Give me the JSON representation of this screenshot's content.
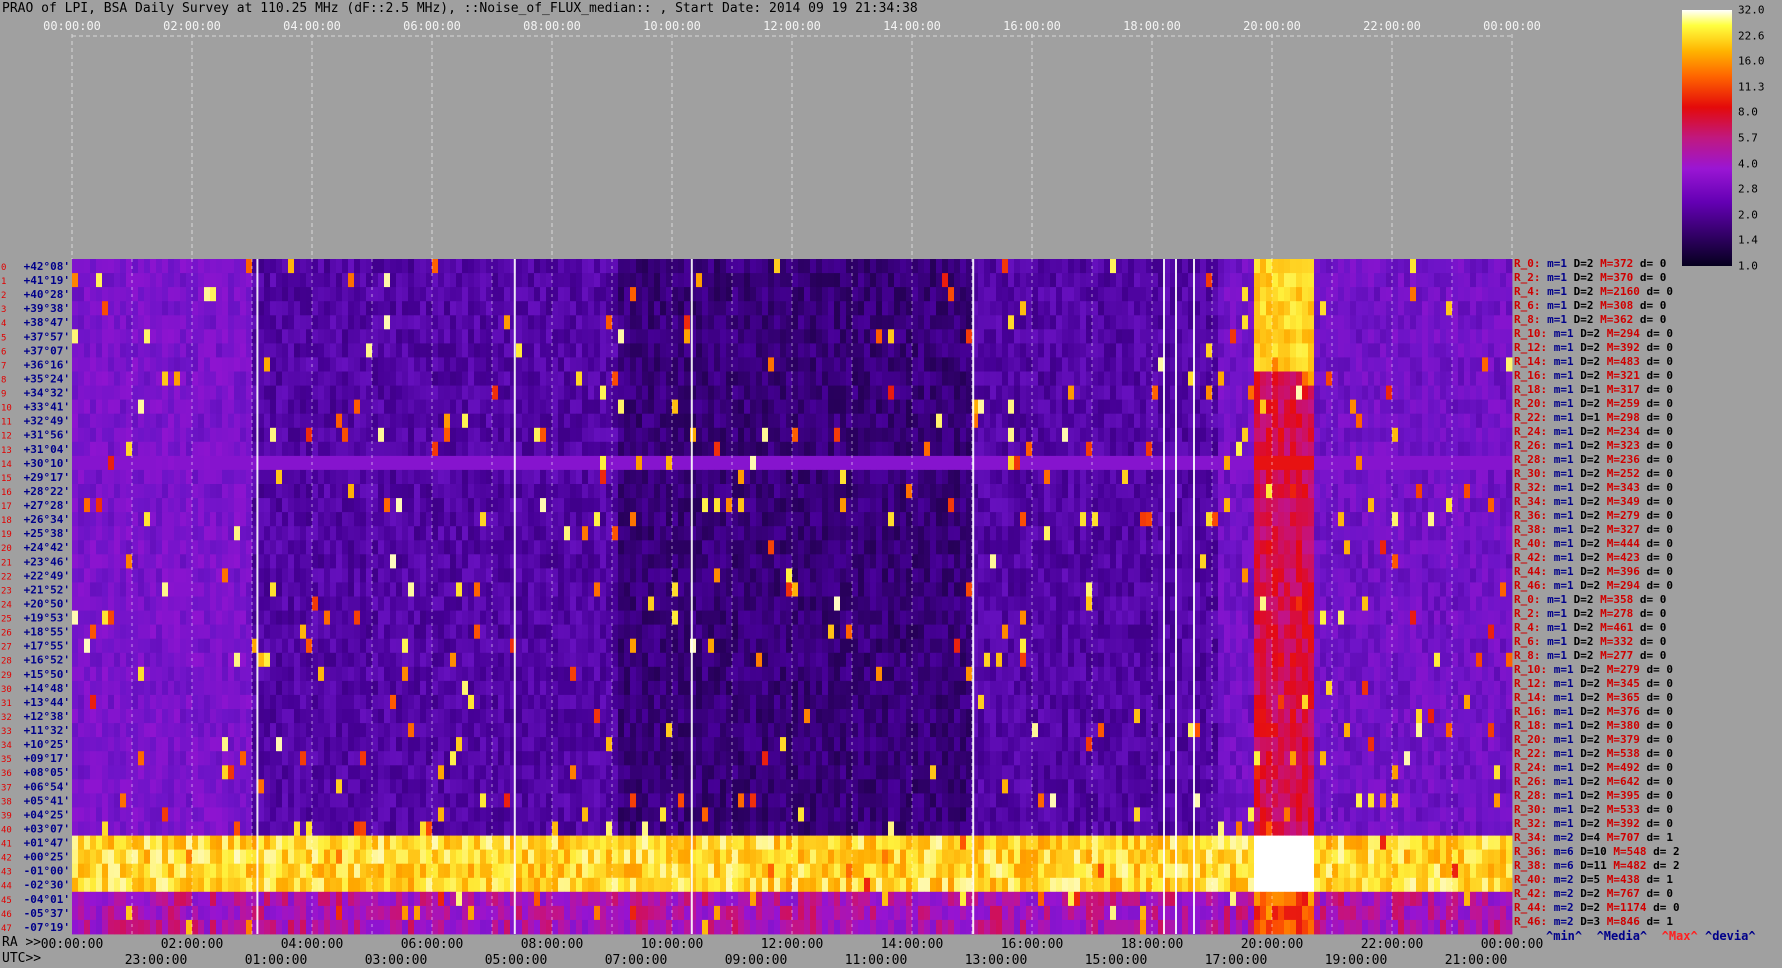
{
  "title": "PRAO of LPI, BSA Daily Survey at 110.25 MHz (dF::2.5 MHz), ::Noise_of_FLUX_median:: , Start Date: 2014 09 19 21:34:38",
  "chart_data": {
    "type": "heatmap",
    "top_time_ticks": [
      "00:00:00",
      "02:00:00",
      "04:00:00",
      "06:00:00",
      "08:00:00",
      "10:00:00",
      "12:00:00",
      "14:00:00",
      "16:00:00",
      "18:00:00",
      "20:00:00",
      "22:00:00",
      "00:00:00"
    ],
    "ra_prefix": "RA >>",
    "ra_ticks": [
      "00:00:00",
      "02:00:00",
      "04:00:00",
      "06:00:00",
      "08:00:00",
      "10:00:00",
      "12:00:00",
      "14:00:00",
      "16:00:00",
      "18:00:00",
      "20:00:00",
      "22:00:00",
      "00:00:00"
    ],
    "utc_prefix": "UTC>>",
    "utc_ticks": [
      "23:00:00",
      "01:00:00",
      "03:00:00",
      "05:00:00",
      "07:00:00",
      "09:00:00",
      "11:00:00",
      "13:00:00",
      "15:00:00",
      "17:00:00",
      "19:00:00",
      "21:00:00"
    ],
    "declinations": [
      "+42°08'",
      "+41°19'",
      "+40°28'",
      "+39°38'",
      "+38°47'",
      "+37°57'",
      "+37°07'",
      "+36°16'",
      "+35°24'",
      "+34°32'",
      "+33°41'",
      "+32°49'",
      "+31°56'",
      "+31°04'",
      "+30°10'",
      "+29°17'",
      "+28°22'",
      "+27°28'",
      "+26°34'",
      "+25°38'",
      "+24°42'",
      "+23°46'",
      "+22°49'",
      "+21°52'",
      "+20°50'",
      "+19°53'",
      "+18°55'",
      "+17°55'",
      "+16°52'",
      "+15°50'",
      "+14°48'",
      "+13°44'",
      "+12°38'",
      "+11°32'",
      "+10°25'",
      "+09°17'",
      "+08°05'",
      "+06°54'",
      "+05°41'",
      "+04°25'",
      "+03°07'",
      "+01°47'",
      "+00°25'",
      "-01°00'",
      "-02°30'",
      "-04°01'",
      "-05°37'",
      "-07°19'"
    ],
    "colorbar_ticks": [
      "32.0",
      "22.6",
      "16.0",
      "11.3",
      "8.0",
      "5.7",
      "4.0",
      "2.8",
      "2.0",
      "1.4",
      "1.0"
    ],
    "legend": {
      "min": "^min^",
      "median": "^Media^",
      "max": "^Max^",
      "devia": "^devia^"
    },
    "stats": [
      {
        "label": "R_0:",
        "min": "m=1",
        "d": "D=2",
        "max": "M=372",
        "dev": "d= 0"
      },
      {
        "label": "R_2:",
        "min": "m=1",
        "d": "D=2",
        "max": "M=370",
        "dev": "d= 0"
      },
      {
        "label": "R_4:",
        "min": "m=1",
        "d": "D=2",
        "max": "M=2160",
        "dev": "d= 0"
      },
      {
        "label": "R_6:",
        "min": "m=1",
        "d": "D=2",
        "max": "M=308",
        "dev": "d= 0"
      },
      {
        "label": "R_8:",
        "min": "m=1",
        "d": "D=2",
        "max": "M=362",
        "dev": "d= 0"
      },
      {
        "label": "R_10:",
        "min": "m=1",
        "d": "D=2",
        "max": "M=294",
        "dev": "d= 0"
      },
      {
        "label": "R_12:",
        "min": "m=1",
        "d": "D=2",
        "max": "M=392",
        "dev": "d= 0"
      },
      {
        "label": "R_14:",
        "min": "m=1",
        "d": "D=2",
        "max": "M=483",
        "dev": "d= 0"
      },
      {
        "label": "R_16:",
        "min": "m=1",
        "d": "D=2",
        "max": "M=321",
        "dev": "d= 0"
      },
      {
        "label": "R_18:",
        "min": "m=1",
        "d": "D=1",
        "max": "M=317",
        "dev": "d= 0"
      },
      {
        "label": "R_20:",
        "min": "m=1",
        "d": "D=2",
        "max": "M=259",
        "dev": "d= 0"
      },
      {
        "label": "R_22:",
        "min": "m=1",
        "d": "D=1",
        "max": "M=298",
        "dev": "d= 0"
      },
      {
        "label": "R_24:",
        "min": "m=1",
        "d": "D=2",
        "max": "M=234",
        "dev": "d= 0"
      },
      {
        "label": "R_26:",
        "min": "m=1",
        "d": "D=2",
        "max": "M=323",
        "dev": "d= 0"
      },
      {
        "label": "R_28:",
        "min": "m=1",
        "d": "D=2",
        "max": "M=236",
        "dev": "d= 0"
      },
      {
        "label": "R_30:",
        "min": "m=1",
        "d": "D=2",
        "max": "M=252",
        "dev": "d= 0"
      },
      {
        "label": "R_32:",
        "min": "m=1",
        "d": "D=2",
        "max": "M=343",
        "dev": "d= 0"
      },
      {
        "label": "R_34:",
        "min": "m=1",
        "d": "D=2",
        "max": "M=349",
        "dev": "d= 0"
      },
      {
        "label": "R_36:",
        "min": "m=1",
        "d": "D=2",
        "max": "M=279",
        "dev": "d= 0"
      },
      {
        "label": "R_38:",
        "min": "m=1",
        "d": "D=2",
        "max": "M=327",
        "dev": "d= 0"
      },
      {
        "label": "R_40:",
        "min": "m=1",
        "d": "D=2",
        "max": "M=444",
        "dev": "d= 0"
      },
      {
        "label": "R_42:",
        "min": "m=1",
        "d": "D=2",
        "max": "M=423",
        "dev": "d= 0"
      },
      {
        "label": "R_44:",
        "min": "m=1",
        "d": "D=2",
        "max": "M=396",
        "dev": "d= 0"
      },
      {
        "label": "R_46:",
        "min": "m=1",
        "d": "D=2",
        "max": "M=294",
        "dev": "d= 0"
      },
      {
        "label": "R_0:",
        "min": "m=1",
        "d": "D=2",
        "max": "M=358",
        "dev": "d= 0"
      },
      {
        "label": "R_2:",
        "min": "m=1",
        "d": "D=2",
        "max": "M=278",
        "dev": "d= 0"
      },
      {
        "label": "R_4:",
        "min": "m=1",
        "d": "D=2",
        "max": "M=461",
        "dev": "d= 0"
      },
      {
        "label": "R_6:",
        "min": "m=1",
        "d": "D=2",
        "max": "M=332",
        "dev": "d= 0"
      },
      {
        "label": "R_8:",
        "min": "m=1",
        "d": "D=2",
        "max": "M=277",
        "dev": "d= 0"
      },
      {
        "label": "R_10:",
        "min": "m=1",
        "d": "D=2",
        "max": "M=279",
        "dev": "d= 0"
      },
      {
        "label": "R_12:",
        "min": "m=1",
        "d": "D=2",
        "max": "M=345",
        "dev": "d= 0"
      },
      {
        "label": "R_14:",
        "min": "m=1",
        "d": "D=2",
        "max": "M=365",
        "dev": "d= 0"
      },
      {
        "label": "R_16:",
        "min": "m=1",
        "d": "D=2",
        "max": "M=376",
        "dev": "d= 0"
      },
      {
        "label": "R_18:",
        "min": "m=1",
        "d": "D=2",
        "max": "M=380",
        "dev": "d= 0"
      },
      {
        "label": "R_20:",
        "min": "m=1",
        "d": "D=2",
        "max": "M=379",
        "dev": "d= 0"
      },
      {
        "label": "R_22:",
        "min": "m=1",
        "d": "D=2",
        "max": "M=538",
        "dev": "d= 0"
      },
      {
        "label": "R_24:",
        "min": "m=1",
        "d": "D=2",
        "max": "M=492",
        "dev": "d= 0"
      },
      {
        "label": "R_26:",
        "min": "m=1",
        "d": "D=2",
        "max": "M=642",
        "dev": "d= 0"
      },
      {
        "label": "R_28:",
        "min": "m=1",
        "d": "D=2",
        "max": "M=395",
        "dev": "d= 0"
      },
      {
        "label": "R_30:",
        "min": "m=1",
        "d": "D=2",
        "max": "M=533",
        "dev": "d= 0"
      },
      {
        "label": "R_32:",
        "min": "m=1",
        "d": "D=2",
        "max": "M=392",
        "dev": "d= 0"
      },
      {
        "label": "R_34:",
        "min": "m=2",
        "d": "D=4",
        "max": "M=707",
        "dev": "d= 1"
      },
      {
        "label": "R_36:",
        "min": "m=6",
        "d": "D=10",
        "max": "M=548",
        "dev": "d= 2"
      },
      {
        "label": "R_38:",
        "min": "m=6",
        "d": "D=11",
        "max": "M=482",
        "dev": "d= 2"
      },
      {
        "label": "R_40:",
        "min": "m=2",
        "d": "D=5",
        "max": "M=438",
        "dev": "d= 1"
      },
      {
        "label": "R_42:",
        "min": "m=2",
        "d": "D=2",
        "max": "M=767",
        "dev": "d= 0"
      },
      {
        "label": "R_44:",
        "min": "m=2",
        "d": "D=2",
        "max": "M=1174",
        "dev": "d= 0"
      },
      {
        "label": "R_46:",
        "min": "m=2",
        "d": "D=3",
        "max": "M=846",
        "dev": "d= 1"
      }
    ]
  }
}
